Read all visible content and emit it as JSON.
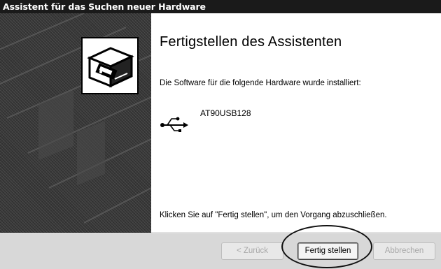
{
  "window": {
    "title": "Assistent für das Suchen neuer Hardware"
  },
  "content": {
    "heading": "Fertigstellen des Assistenten",
    "description": "Die Software für die folgende Hardware wurde installiert:",
    "device": {
      "icon": "usb-icon",
      "name": "AT90USB128"
    },
    "footer_text": "Klicken Sie auf \"Fertig stellen\", um den Vorgang abzuschließen."
  },
  "buttons": {
    "back_label": "< Zurück",
    "finish_label": "Fertig stellen",
    "cancel_label": "Abbrechen"
  },
  "icons": {
    "wizard_graphic": "hardware-installer-icon",
    "device_icon": "usb-icon"
  },
  "colors": {
    "title_bar": "#1a1a1a",
    "side_panel": "#373737",
    "button_bar": "#d8d8d8",
    "disabled_text": "#a8a8a8"
  }
}
